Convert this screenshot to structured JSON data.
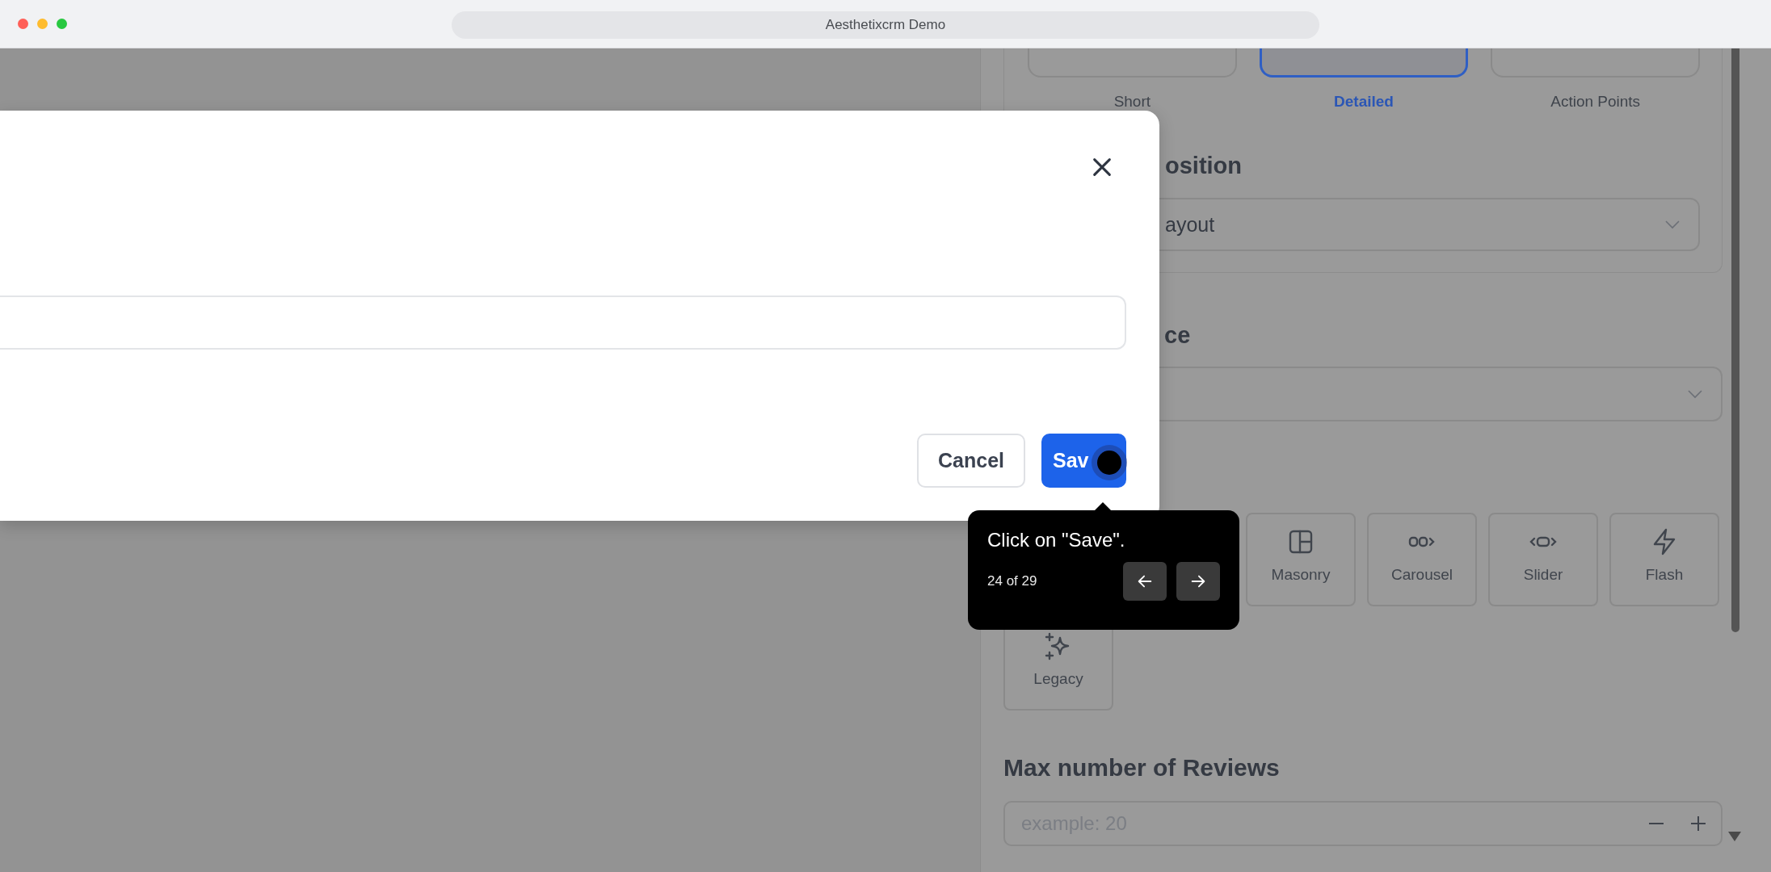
{
  "window": {
    "title": "Aesthetixcrm Demo"
  },
  "panel": {
    "summary_options": [
      {
        "label": "Short",
        "selected": false
      },
      {
        "label": "Detailed",
        "selected": true
      },
      {
        "label": "Action Points",
        "selected": false
      }
    ],
    "position_heading": "osition",
    "position_select": {
      "value": "ayout"
    },
    "second_heading": "ce",
    "layout_options": [
      {
        "label": "Masonry",
        "kind": "masonry"
      },
      {
        "label": "Carousel",
        "kind": "carousel"
      },
      {
        "label": "Slider",
        "kind": "slider"
      },
      {
        "label": "Flash",
        "kind": "flash"
      },
      {
        "label": "Legacy",
        "kind": "sparkle"
      }
    ],
    "max_reviews": {
      "label": "Max number of Reviews",
      "placeholder": "example: 20"
    }
  },
  "modal": {
    "buttons": [
      {
        "label": "Cancel",
        "kind": "secondary"
      },
      {
        "label": "Sav",
        "kind": "primary"
      }
    ]
  },
  "tooltip": {
    "text": "Click on \"Save\".",
    "step": "24 of 29"
  }
}
